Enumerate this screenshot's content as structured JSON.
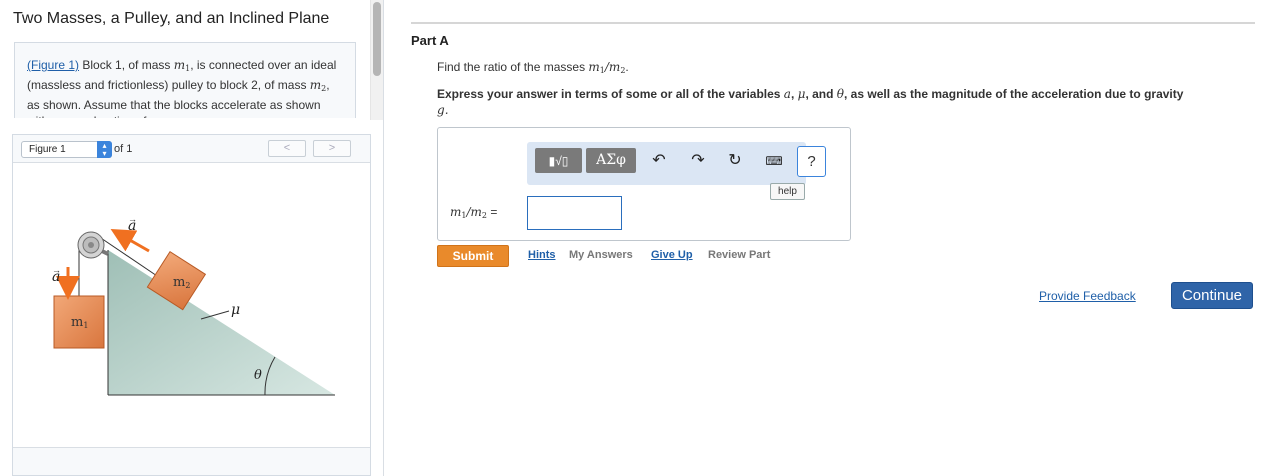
{
  "title": "Two Masses, a Pulley, and an Inclined Plane",
  "description": {
    "figure_link": "(Figure 1)",
    "text_1": " Block 1, of mass ",
    "m1": "m",
    "m1_sub": "1",
    "text_2": ", is connected over an ideal (massless and frictionless) pulley to block 2, of mass ",
    "m2": "m",
    "m2_sub": "2",
    "text_3": ", as shown. Assume that the blocks accelerate as shown with an acceleration of"
  },
  "figure": {
    "select_value": "Figure 1",
    "of_label": "of 1",
    "prev_label": "<",
    "next_label": ">",
    "labels": {
      "accel_left": "a",
      "accel_top": "a",
      "mass1": "m",
      "mass1_sub": "1",
      "mass2": "m",
      "mass2_sub": "2",
      "mu": "μ",
      "theta": "θ"
    },
    "colors": {
      "block": "#e8894e",
      "incline": "#b9d2cb",
      "arrow": "#f07020"
    }
  },
  "part": {
    "title": "Part A",
    "question_pre": "Find the ratio of the masses ",
    "question_var": "m",
    "question_sub1": "1",
    "question_mid": "/m",
    "question_sub2": "2",
    "question_post": ".",
    "instructions_pre": "Express your answer in terms of some or all of the variables ",
    "var_a": "a",
    "sep1": ", ",
    "var_mu": "μ",
    "sep2": ", and ",
    "var_theta": "θ",
    "instructions_post": ", as well as the magnitude of the acceleration due to gravity ",
    "var_g": "g",
    "instructions_end": "."
  },
  "answer": {
    "label_var": "m",
    "label_sub1": "1",
    "label_mid": "/m",
    "label_sub2": "2",
    "label_eq": " =",
    "value": "",
    "toolbar": {
      "templates_icon": "templates-icon",
      "greek_label": "ΑΣφ",
      "undo_icon": "undo-icon",
      "redo_icon": "redo-icon",
      "reset_icon": "reset-icon",
      "keyboard_icon": "keyboard-icon",
      "help_label": "?",
      "help_tooltip": "help"
    }
  },
  "actions": {
    "submit": "Submit",
    "hints": "Hints",
    "my_answers": "My Answers",
    "give_up": "Give Up",
    "review_part": "Review Part",
    "provide_feedback": "Provide Feedback",
    "continue": "Continue"
  },
  "colors": {
    "accent": "#2f64a8",
    "submit": "#e98a2b",
    "link": "#1f5fa8"
  }
}
